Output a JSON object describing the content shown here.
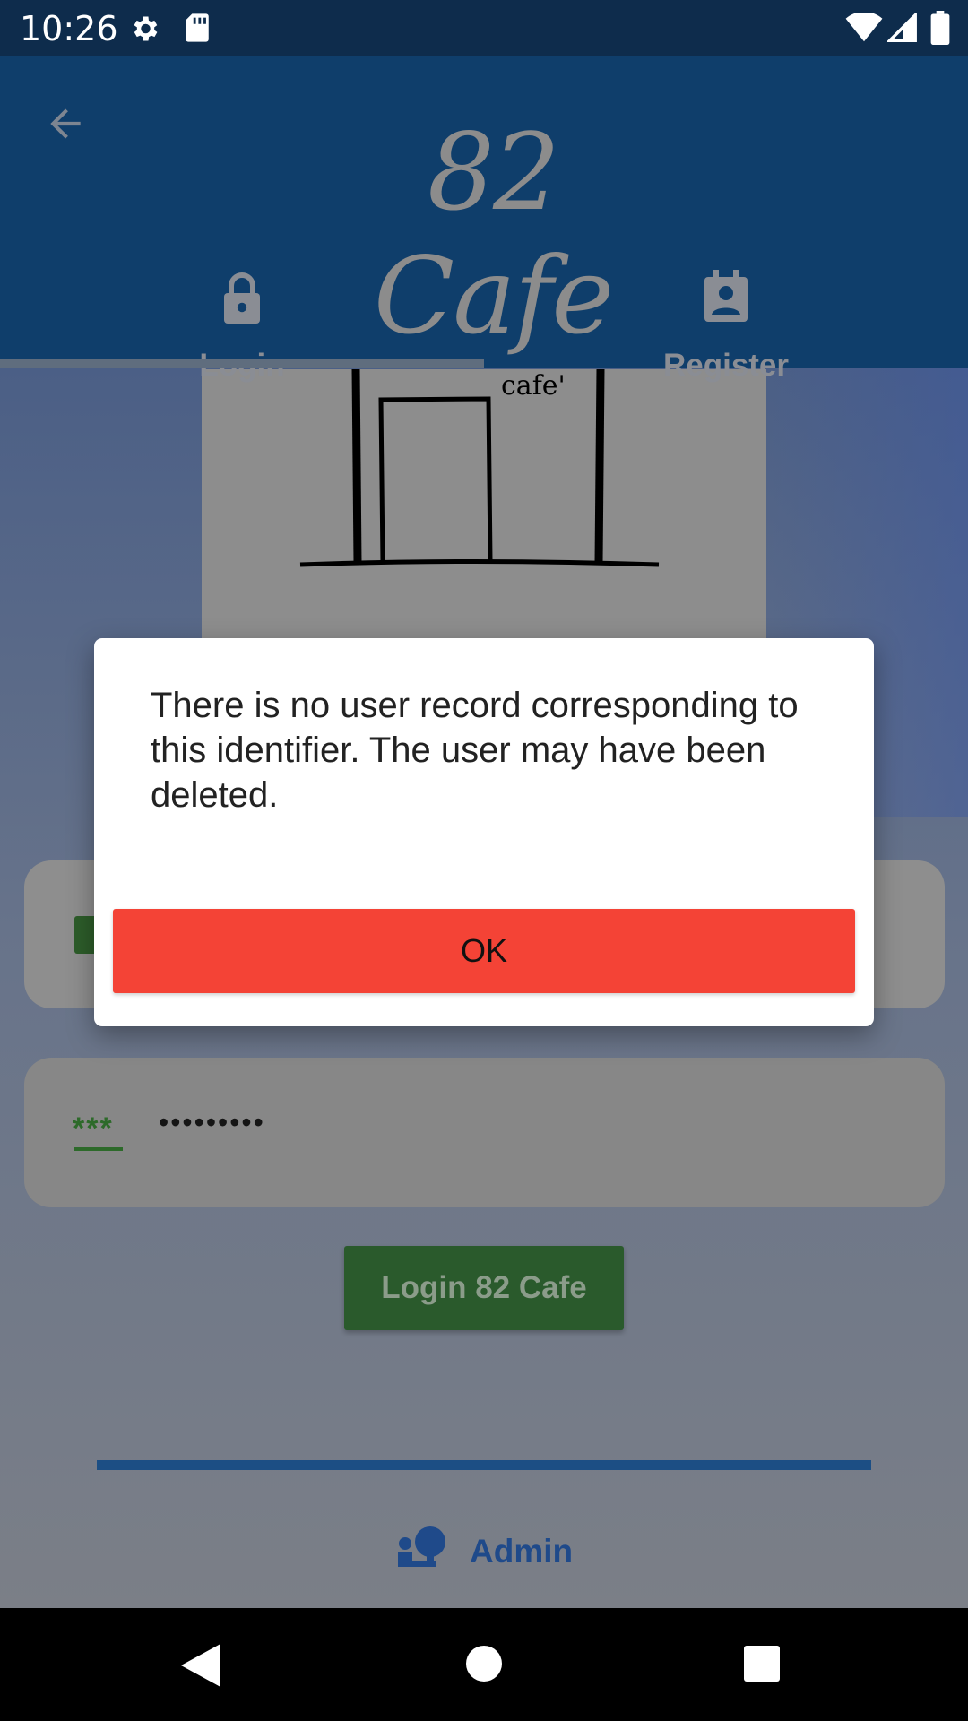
{
  "status_bar": {
    "time": "10:26"
  },
  "app_bar": {
    "brand": "82 Cafe"
  },
  "tabs": [
    {
      "label": "Login",
      "icon": "lock-icon",
      "selected": true
    },
    {
      "label": "Register",
      "icon": "contact-card-icon",
      "selected": false
    }
  ],
  "hero": {
    "caption": "cafe'"
  },
  "form": {
    "password_icon": "***",
    "password_value": "•••••••••",
    "login_button": "Login 82 Cafe"
  },
  "admin": {
    "label": "Admin"
  },
  "dialog": {
    "message": "There is no user record corresponding to this identifier. The user may have been deleted.",
    "ok": "OK"
  },
  "colors": {
    "accent": "#0f3e6b",
    "dialog_button": "#f44336",
    "login_button": "#2e7d32"
  }
}
